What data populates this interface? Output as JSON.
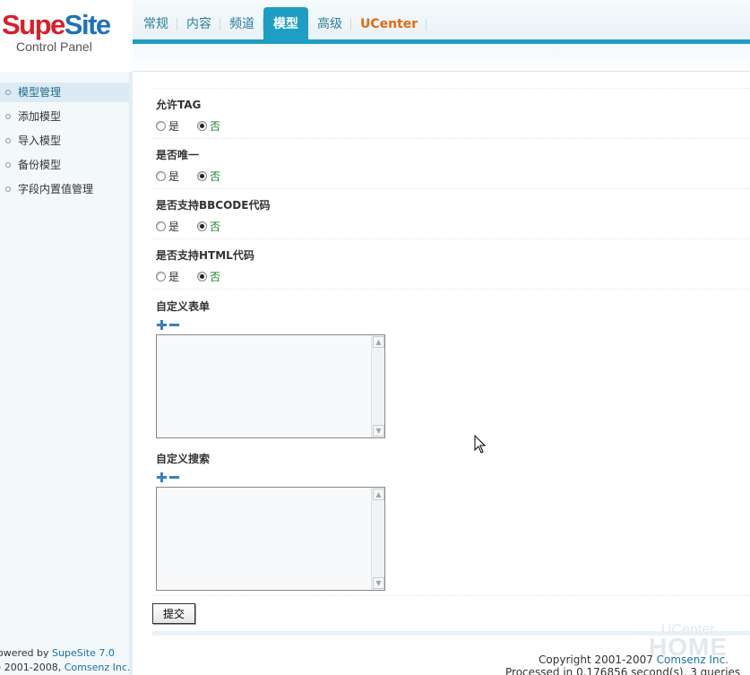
{
  "logo": {
    "brand_a": "Supe",
    "brand_b": "Site",
    "subtitle": "Control Panel"
  },
  "nav": {
    "items": [
      {
        "label": "常规"
      },
      {
        "label": "内容"
      },
      {
        "label": "频道"
      },
      {
        "label": "模型"
      },
      {
        "label": "高级"
      },
      {
        "label": "UCenter"
      }
    ],
    "active": "模型"
  },
  "sidebar": {
    "items": [
      {
        "label": "模型管理"
      },
      {
        "label": "添加模型"
      },
      {
        "label": "导入模型"
      },
      {
        "label": "备份模型"
      },
      {
        "label": "字段内置值管理"
      }
    ],
    "footer": {
      "powered_prefix": "owered by ",
      "powered_link": "SupeSite 7.0",
      "copy_prefix": ") 2001-2008, ",
      "copy_link": "Comsenz Inc."
    }
  },
  "form": {
    "rows": [
      {
        "title": "允许TAG",
        "opt_yes": "是",
        "opt_no": "否",
        "selected": "否"
      },
      {
        "title": "是否唯一",
        "opt_yes": "是",
        "opt_no": "否",
        "selected": "否"
      },
      {
        "title": "是否支持BBCODE代码",
        "opt_yes": "是",
        "opt_no": "否",
        "selected": "否"
      },
      {
        "title": "是否支持HTML代码",
        "opt_yes": "是",
        "opt_no": "否",
        "selected": "否"
      }
    ],
    "custom_form": {
      "title": "自定义表单",
      "value": ""
    },
    "custom_search": {
      "title": "自定义搜索",
      "value": ""
    },
    "submit_label": "提交"
  },
  "footer": {
    "copyright_prefix": "Copyright 2001-2007 ",
    "copyright_link": "Comsenz Inc.",
    "processed": "Processed in 0.176856 second(s), 3 queries"
  },
  "watermark": {
    "top": "UCenter",
    "main": "HOME"
  },
  "colors": {
    "accent": "#1d9ec4",
    "ucenter": "#e36a10",
    "brand_red": "#d8202a",
    "brand_blue": "#1e73b8",
    "checked_label": "#1a7f2a"
  }
}
